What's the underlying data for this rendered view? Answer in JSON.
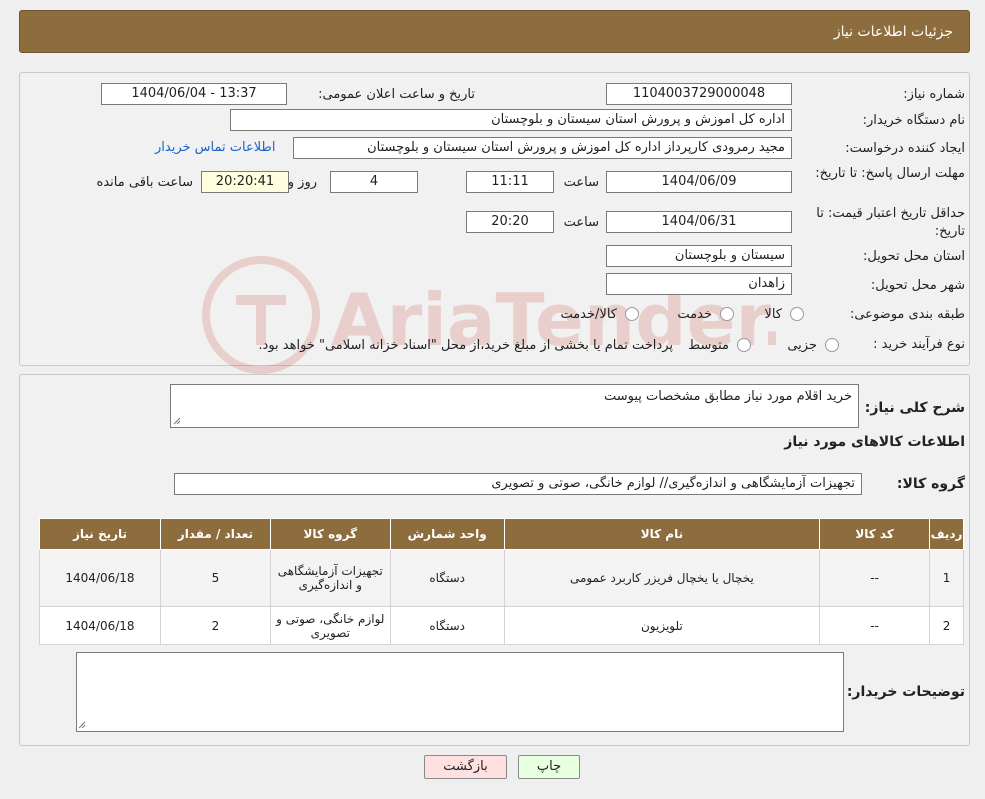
{
  "header": {
    "title": "جزئیات اطلاعات نیاز"
  },
  "fields": {
    "need_number_label": "شماره نیاز:",
    "need_number": "1104003729000048",
    "announce_label": "تاریخ و ساعت اعلان عمومی:",
    "announce_value": "1404/06/04 - 13:37",
    "buyer_org_label": "نام دستگاه خریدار:",
    "buyer_org": "اداره کل اموزش و پرورش استان سیستان و بلوچستان",
    "requester_label": "ایجاد کننده درخواست:",
    "requester": "مجید رمرودی کارپرداز اداره کل اموزش و پرورش استان سیستان و بلوچستان",
    "contact_link": "اطلاعات تماس خریدار",
    "reply_deadline_label": "مهلت ارسال پاسخ: تا تاریخ:",
    "reply_date": "1404/06/09",
    "time_label": "ساعت",
    "reply_time": "11:11",
    "days": "4",
    "days_label": "روز و",
    "remaining": "20:20:41",
    "remaining_label": "ساعت باقی مانده",
    "price_validity_label": "حداقل تاریخ اعتبار قیمت: تا تاریخ:",
    "price_date": "1404/06/31",
    "price_time": "20:20",
    "province_label": "استان محل تحویل:",
    "province": "سیستان و بلوچستان",
    "city_label": "شهر محل تحویل:",
    "city": "زاهدان",
    "category_label": "طبقه بندی موضوعی:",
    "category_options": [
      "کالا",
      "خدمت",
      "کالا/خدمت"
    ],
    "process_label": "نوع فرآیند خرید :",
    "process_options": [
      "جزیی",
      "متوسط"
    ],
    "process_note": "پرداخت تمام یا بخشی از مبلغ خرید،از محل \"اسناد خزانه اسلامی\" خواهد بود."
  },
  "summary": {
    "label": "شرح کلی نیاز:",
    "value": "خرید اقلام مورد نیاز مطابق مشخصات پیوست",
    "goods_info_title": "اطلاعات کالاهای مورد نیاز",
    "group_label": "گروه کالا:",
    "group_value": "تجهیزات آزمایشگاهی و اندازه‌گیری// لوازم خانگی، صوتی و تصویری"
  },
  "table": {
    "headers": [
      "ردیف",
      "کد کالا",
      "نام کالا",
      "واحد شمارش",
      "گروه کالا",
      "تعداد / مقدار",
      "تاریخ نیاز"
    ],
    "rows": [
      [
        "1",
        "--",
        "یخچال یا یخچال فریزر کاربرد عمومی",
        "دستگاه",
        "تجهیزات آزمایشگاهی و اندازه‌گیری",
        "5",
        "1404/06/18"
      ],
      [
        "2",
        "--",
        "تلویزیون",
        "دستگاه",
        "لوازم خانگی، صوتی و تصویری",
        "2",
        "1404/06/18"
      ]
    ]
  },
  "buyer_notes": {
    "label": "توضیحات خریدار:",
    "value": ""
  },
  "buttons": {
    "print": "چاپ",
    "back": "بازگشت"
  },
  "watermark": {
    "text": "AriaTender.neT"
  },
  "colors": {
    "header_bg": "#8d6c3e",
    "back_btn": "#ffe0e0",
    "print_btn": "#e8ffe0"
  }
}
